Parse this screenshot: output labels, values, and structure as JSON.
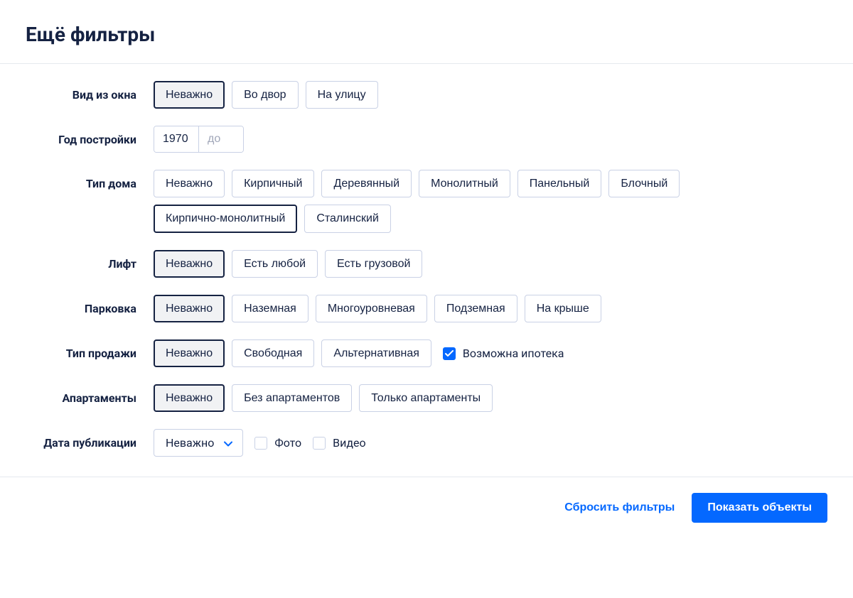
{
  "title": "Ещё фильтры",
  "rows": {
    "view": {
      "label": "Вид из окна",
      "options": [
        "Неважно",
        "Во двор",
        "На улицу"
      ],
      "active": 0
    },
    "year": {
      "label": "Год постройки",
      "from": "1970",
      "to_placeholder": "до"
    },
    "house_type": {
      "label": "Тип дома",
      "options": [
        "Неважно",
        "Кирпичный",
        "Деревянный",
        "Монолитный",
        "Панельный",
        "Блочный",
        "Кирпично-монолитный",
        "Сталинский"
      ],
      "hover": 6
    },
    "lift": {
      "label": "Лифт",
      "options": [
        "Неважно",
        "Есть любой",
        "Есть грузовой"
      ],
      "active": 0
    },
    "parking": {
      "label": "Парковка",
      "options": [
        "Неважно",
        "Наземная",
        "Многоуровневая",
        "Подземная",
        "На крыше"
      ],
      "active": 0
    },
    "sale_type": {
      "label": "Тип продажи",
      "options": [
        "Неважно",
        "Свободная",
        "Альтернативная"
      ],
      "active": 0,
      "checkbox_label": "Возможна ипотека",
      "checkbox_checked": true
    },
    "apartments": {
      "label": "Апартаменты",
      "options": [
        "Неважно",
        "Без апартаментов",
        "Только апартаменты"
      ],
      "active": 0
    },
    "pub_date": {
      "label": "Дата публикации",
      "select": "Неважно",
      "checks": [
        {
          "label": "Фото",
          "checked": false
        },
        {
          "label": "Видео",
          "checked": false
        }
      ]
    }
  },
  "footer": {
    "reset": "Сбросить фильтры",
    "submit": "Показать объекты"
  }
}
